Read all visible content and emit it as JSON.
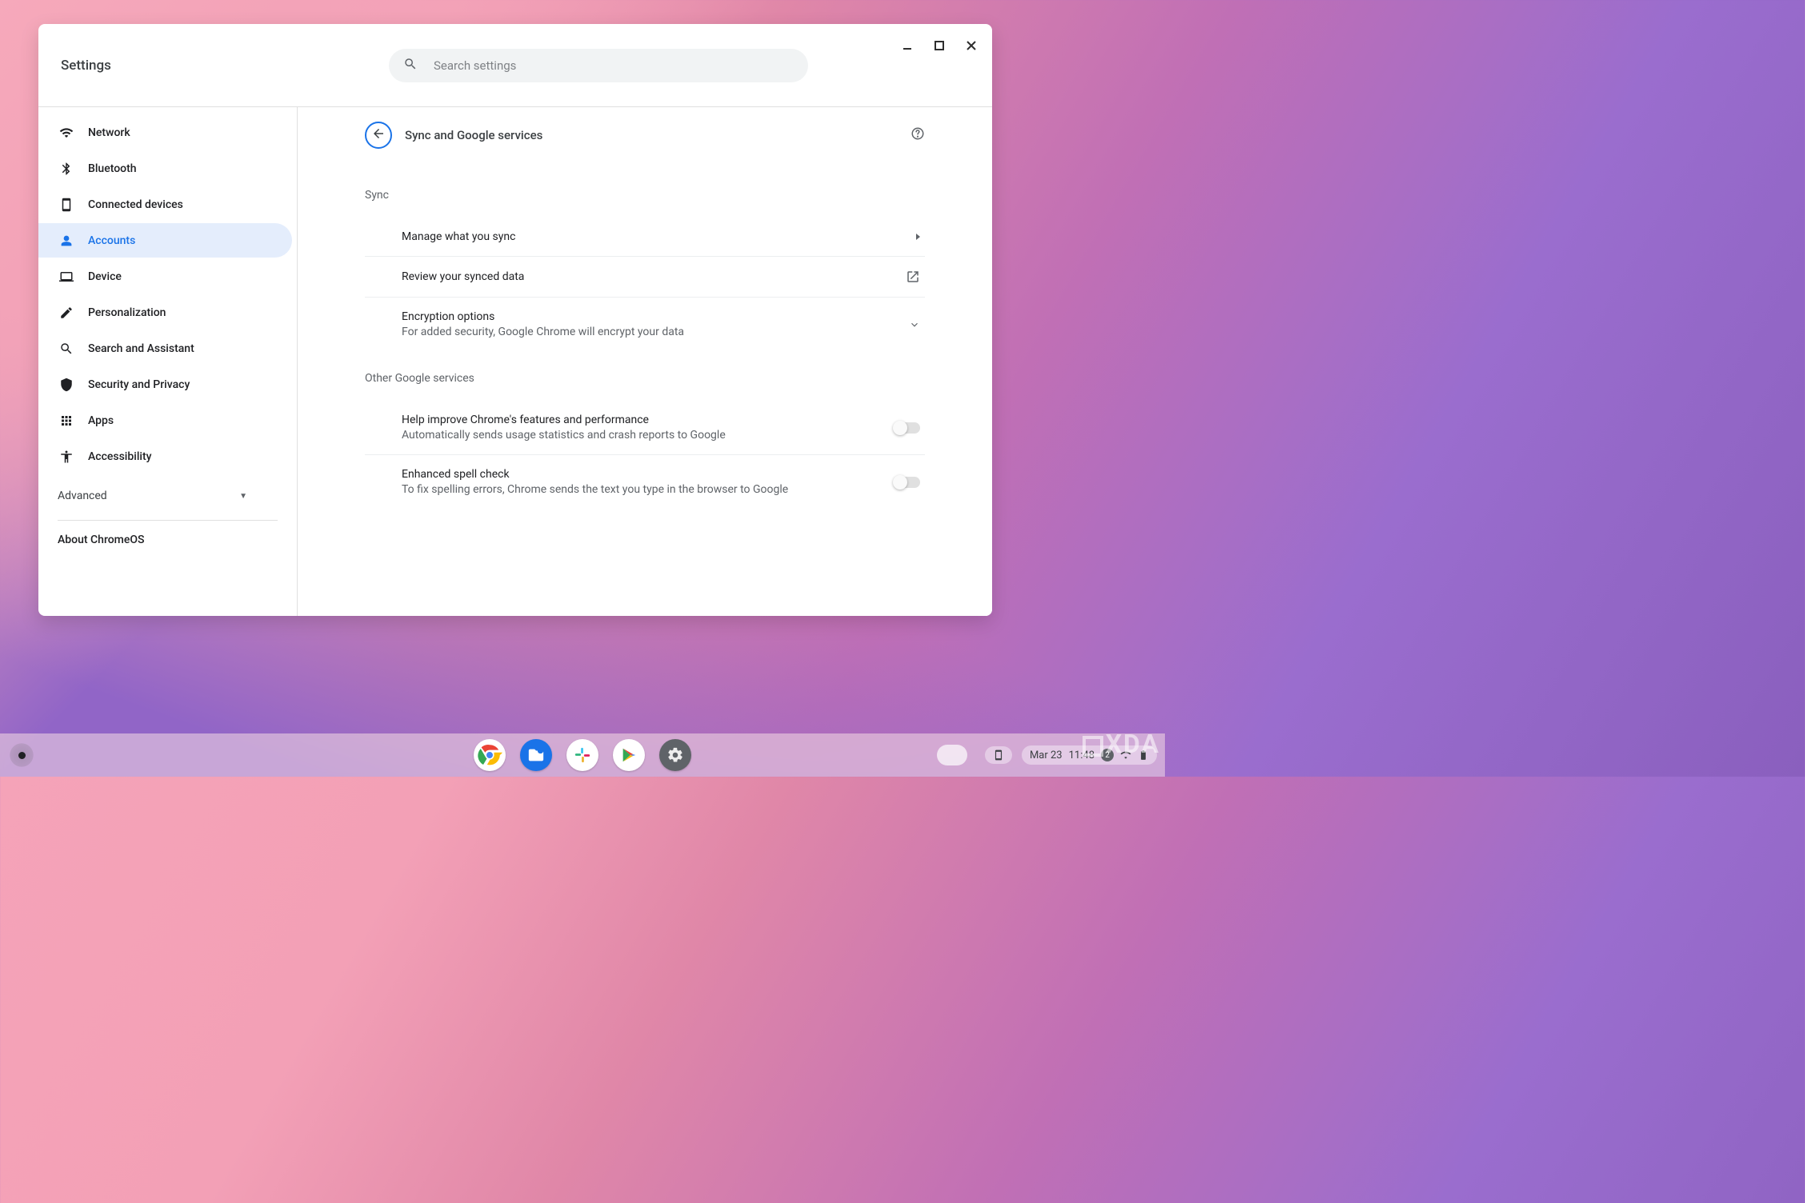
{
  "header": {
    "title": "Settings",
    "search_placeholder": "Search settings"
  },
  "sidebar": {
    "items": [
      {
        "id": "network",
        "label": "Network"
      },
      {
        "id": "bluetooth",
        "label": "Bluetooth"
      },
      {
        "id": "connected-devices",
        "label": "Connected devices"
      },
      {
        "id": "accounts",
        "label": "Accounts"
      },
      {
        "id": "device",
        "label": "Device"
      },
      {
        "id": "personalization",
        "label": "Personalization"
      },
      {
        "id": "search-assistant",
        "label": "Search and Assistant"
      },
      {
        "id": "security-privacy",
        "label": "Security and Privacy"
      },
      {
        "id": "apps",
        "label": "Apps"
      },
      {
        "id": "accessibility",
        "label": "Accessibility"
      }
    ],
    "advanced_label": "Advanced",
    "about_label": "About ChromeOS"
  },
  "main": {
    "page_title": "Sync and Google services",
    "sections": {
      "sync": {
        "label": "Sync",
        "manage": "Manage what you sync",
        "review": "Review your synced data",
        "encryption_title": "Encryption options",
        "encryption_sub": "For added security, Google Chrome will encrypt your data"
      },
      "other": {
        "label": "Other Google services",
        "improve_title": "Help improve Chrome's features and performance",
        "improve_sub": "Automatically sends usage statistics and crash reports to Google",
        "spell_title": "Enhanced spell check",
        "spell_sub": "To fix spelling errors, Chrome sends the text you type in the browser to Google"
      }
    }
  },
  "shelf": {
    "apps": [
      "chrome",
      "files",
      "slack",
      "play-store",
      "settings"
    ],
    "date": "Mar 23",
    "time": "11:48",
    "notification_count": "2"
  },
  "watermark": "XDA"
}
